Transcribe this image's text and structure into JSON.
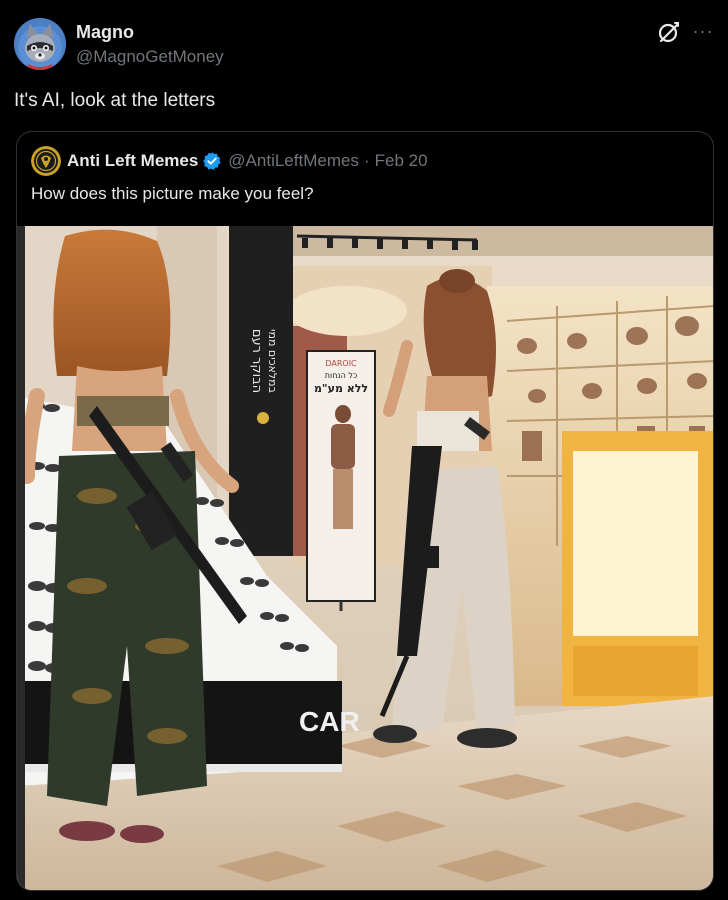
{
  "post": {
    "author_name": "Magno",
    "author_handle": "@MagnoGetMoney",
    "text": "It's AI, look at the letters",
    "more_label": "···"
  },
  "quoted": {
    "author_name": "Anti Left Memes",
    "author_handle": "@AntiLeftMemes",
    "separator": "·",
    "date": "Feb 20",
    "text": "How does this picture make you feel?",
    "verified_color": "#1d9bf0",
    "image": {
      "kiosk_sign": "CAR",
      "poster_title": "DAROIC",
      "poster_line1": "כל הנחות",
      "poster_line2": "ללא מע\"מ",
      "pillar_text_1": "הבוקר רעם",
      "pillar_text_2": "במלאכים ממי"
    }
  },
  "colors": {
    "background": "#000000",
    "text_primary": "#e7e9ea",
    "text_secondary": "#71767b",
    "border": "#2f3336"
  }
}
